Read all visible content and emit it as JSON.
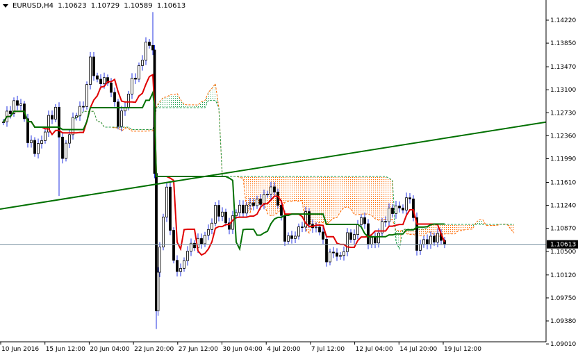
{
  "header": {
    "symbol": "EURUSD,H4",
    "open": "1.10623",
    "high": "1.10729",
    "low": "1.10589",
    "close": "1.10613"
  },
  "colors": {
    "bull_wick": "#2030e0",
    "tenkan": "#e00000",
    "kijun": "#007000",
    "trendline": "#007000",
    "cloud_up": "#20a050",
    "cloud_down": "#ff6a00",
    "price_line": "#7890a0"
  },
  "chart_data": {
    "type": "candlestick",
    "title": "EURUSD,H4",
    "ylim": [
      1.0901,
      1.1459
    ],
    "y_ticks": [
      "1.14220",
      "1.13850",
      "1.13470",
      "1.13100",
      "1.12730",
      "1.12360",
      "1.11990",
      "1.11610",
      "1.11240",
      "1.10870",
      "1.10500",
      "1.10120",
      "1.09750",
      "1.09380",
      "1.09010"
    ],
    "x_ticks": [
      "10 Jun 2016",
      "15 Jun 12:00",
      "20 Jun 04:00",
      "22 Jun 20:00",
      "27 Jun 12:00",
      "30 Jun 04:00",
      "4 Jul 20:00",
      "7 Jul 12:00",
      "12 Jul 04:00",
      "14 Jul 20:00",
      "19 Jul 12:00"
    ],
    "current_price": "1.10613",
    "closes": [
      1.1258,
      1.127,
      1.1286,
      1.1286,
      1.123,
      1.1214,
      1.123,
      1.1264,
      1.1275,
      1.1197,
      1.1242,
      1.1275,
      1.1286,
      1.1359,
      1.132,
      1.1326,
      1.1309,
      1.1258,
      1.1286,
      1.1326,
      1.1342,
      1.1382,
      1.1376,
      1.0961,
      1.1062,
      1.1152,
      1.1029,
      1.1017,
      1.1051,
      1.1062,
      1.1068,
      1.1085,
      1.1118,
      1.1107,
      1.1085,
      1.1118,
      1.1118,
      1.1129,
      1.1129,
      1.1135,
      1.1152,
      1.1129,
      1.1073,
      1.1073,
      1.1085,
      1.1107,
      1.1085,
      1.1085,
      1.104,
      1.1051,
      1.104,
      1.1073,
      1.1073,
      1.1107,
      1.1068,
      1.1068,
      1.1096,
      1.1113,
      1.1118,
      1.1118,
      1.1141,
      1.1057,
      1.1068,
      1.1068,
      1.1073,
      1.1061
    ],
    "trendline": {
      "start_price": 1.1118,
      "end_price": 1.1258
    }
  }
}
